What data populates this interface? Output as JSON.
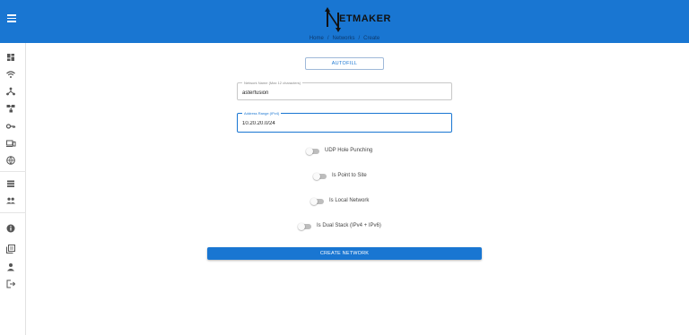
{
  "header": {
    "logo_text": "ETMAKER",
    "brand_color": "#1976d2"
  },
  "breadcrumb": {
    "home": "Home",
    "networks": "Networks",
    "create": "Create",
    "separator": "/"
  },
  "sidebar": {
    "items": [
      {
        "icon": "dashboard-icon"
      },
      {
        "icon": "wifi-icon"
      },
      {
        "icon": "nodes-icon"
      },
      {
        "icon": "hosts-icon"
      },
      {
        "icon": "key-icon"
      },
      {
        "icon": "devices-icon"
      },
      {
        "icon": "globe-icon"
      },
      {
        "icon": "list-icon"
      },
      {
        "icon": "users-icon"
      },
      {
        "icon": "info-icon"
      },
      {
        "icon": "library-icon"
      },
      {
        "icon": "person-icon"
      },
      {
        "icon": "logout-icon"
      }
    ]
  },
  "form": {
    "autofill_label": "AUTOFILL",
    "network_name": {
      "label": "Network Name (Max 12 characters)",
      "value": "asterfusion"
    },
    "address_range": {
      "label": "Address Range (IPv4)",
      "value": "10.20.20.0/24"
    },
    "toggles": [
      {
        "label": "UDP Hole Punching",
        "on": false
      },
      {
        "label": "Is Point to Site",
        "on": false
      },
      {
        "label": "Is Local Network",
        "on": false
      },
      {
        "label": "Is Dual Stack (IPv4 + IPv6)",
        "on": false
      }
    ],
    "submit_label": "CREATE NETWORK"
  }
}
